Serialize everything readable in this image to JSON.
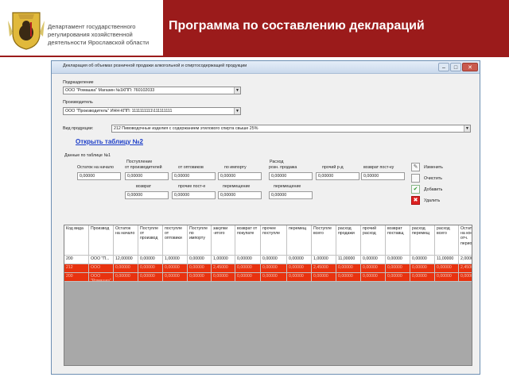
{
  "header": {
    "department": "Департамент государственного регулирования хозяйственной деятельности Ярославской области",
    "title": "Программа по составлению деклараций",
    "bar_color": "#9b1b1b",
    "emblem_icon": "yaroslavl-bear-coat-of-arms-icon"
  },
  "window": {
    "title": "Декларация об объемах розничной продажи алкогольной и спиртосодержащей продукции",
    "buttons": {
      "minimize": "–",
      "maximize": "□",
      "close": "✕"
    },
    "subdivision": {
      "label": "Подразделение",
      "value": "ООО \"Ромашка\" Магазин №1КПП: 760102033"
    },
    "producer": {
      "label": "Производитель",
      "value": "ООО \"Производитель\" ИНН-КПП: 1111111111\\111111111"
    },
    "product_type": {
      "label": "Вид продукции:",
      "value": "212 Пивоводочные изделия с содержанием этилового спирта свыше 25%"
    },
    "open_table_link": "Открыть таблицу №2",
    "table1_caption": "Данные по таблице №1"
  },
  "form": {
    "opening_balance_label": "Остаток на начало",
    "opening_balance_value": "0,00000",
    "receipt_group_label": "Поступление",
    "expense_group_label": "Расход",
    "row1": [
      {
        "label": "от производителей",
        "value": "0,00000"
      },
      {
        "label": "от оптовиков",
        "value": "0,00000"
      },
      {
        "label": "по импорту",
        "value": "0,00000"
      },
      {
        "label": "розн. продажа",
        "value": "0,00000"
      },
      {
        "label": "прочий р-д",
        "value": "0,00000"
      },
      {
        "label": "возврат пост-ку",
        "value": "0,00000"
      }
    ],
    "row2": [
      {
        "label": "возврат",
        "value": "0,00000"
      },
      {
        "label": "прочие пост-е",
        "value": "0,00000"
      },
      {
        "label": "перемещение",
        "value": "0,00000"
      },
      {
        "label": "перемещение",
        "value": "0,00000"
      }
    ]
  },
  "actions": [
    {
      "label": "Изменить",
      "icon": "edit-icon",
      "glyph": "✎"
    },
    {
      "label": "Очистить",
      "icon": "clear-icon",
      "glyph": ""
    },
    {
      "label": "Добавить",
      "icon": "add-checkmark-icon",
      "glyph": "✔"
    },
    {
      "label": "Удалить",
      "icon": "delete-x-icon",
      "glyph": "✖"
    }
  ],
  "grid": {
    "columns": [
      "Код вида",
      "Производ",
      "Остаток на начало",
      "Поступле от производ",
      "поступле от оптовики",
      "Поступле по импорту",
      "закупки -итого",
      "возврат от покупате",
      "прочее поступле",
      "перемещ",
      "Поступле всего",
      "расход продажи",
      "прочий расход",
      "возврат поставщ",
      "расход перемещ",
      "расход всего",
      "Остаток на конец отч. период"
    ],
    "rows": [
      [
        "200",
        "ООО \"П...",
        "12,00000",
        "0,00000",
        "1,00000",
        "0,00000",
        "1,00000",
        "0,00000",
        "0,00000",
        "0,00000",
        "1,00000",
        "11,00000",
        "0,00000",
        "0,00000",
        "0,00000",
        "11,00000",
        "2,00000"
      ],
      [
        "212",
        "ООО",
        "0,00000",
        "0,00000",
        "0,00000",
        "0,00000",
        "2,45000",
        "0,00000",
        "0,00000",
        "0,00000",
        "2,45000",
        "0,00000",
        "0,00000",
        "0,00000",
        "0,00000",
        "0,00000",
        "2,45000"
      ],
      [
        "200",
        "ООО \"Ромашка\"",
        "0,00000",
        "0,00000",
        "0,00000",
        "0,00000",
        "0,00000",
        "0,00000",
        "0,00000",
        "0,00000",
        "0,00000",
        "0,00000",
        "0,00000",
        "0,00000",
        "0,00000",
        "0,00000",
        "0,00000"
      ]
    ],
    "highlight_color": "#e8320f"
  }
}
